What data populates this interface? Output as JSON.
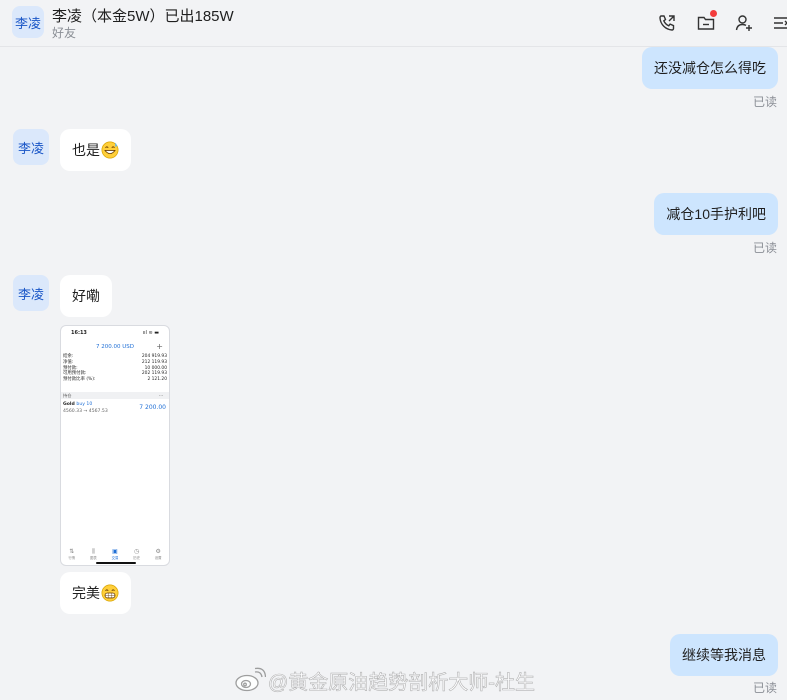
{
  "header": {
    "avatar_text": "李凌",
    "contact_name": "李凌（本金5W）已出185W",
    "subtitle": "好友",
    "icons": [
      "phone-share-icon",
      "folder-icon",
      "add-user-icon",
      "menu-list-icon"
    ]
  },
  "messages": [
    {
      "side": "out",
      "text": "还没减仓怎么得吃",
      "status": "已读"
    },
    {
      "side": "in",
      "avatar": "李凌",
      "text": "也是",
      "emoji": "beaming-grin-sweat-emoji"
    },
    {
      "side": "out",
      "text": "减仓10手护利吧",
      "status": "已读"
    },
    {
      "side": "in",
      "avatar": "李凌",
      "text": "好嘞"
    },
    {
      "side": "in",
      "type": "image"
    },
    {
      "side": "in",
      "text": "完美",
      "emoji": "grinning-emoji"
    },
    {
      "side": "out",
      "text": "继续等我消息",
      "status": "已读"
    }
  ],
  "screenshot": {
    "status_time": "16:13",
    "status_right": "ııl ≋ ▬",
    "balance": "7 200.00 USD",
    "plus": "+",
    "rows": [
      {
        "label": "结余:",
        "value": "204 919.93"
      },
      {
        "label": "净值:",
        "value": "212 119.93"
      },
      {
        "label": "预付款:",
        "value": "10 000.00"
      },
      {
        "label": "可用预付款:",
        "value": "202 119.93"
      },
      {
        "label": "预付款比率 (%):",
        "value": "2 121.20"
      }
    ],
    "section": "持仓",
    "section_more": "···",
    "position_symbol": "Gold",
    "position_side": "buy 10",
    "position_prices": "4560.33 → 4567.53",
    "position_pnl": "7 200.00",
    "tabs": [
      {
        "icon": "⇅",
        "label": "行情"
      },
      {
        "icon": "⫼",
        "label": "图表"
      },
      {
        "icon": "▣",
        "label": "交易"
      },
      {
        "icon": "◷",
        "label": "历史"
      },
      {
        "icon": "⚙",
        "label": "设置"
      }
    ]
  },
  "watermark": {
    "text": "@黄金原油趋势剖析大师-杜生"
  },
  "colors": {
    "background": "#f2f3f5",
    "incoming_bubble": "#ffffff",
    "outgoing_bubble": "#cde5fe",
    "avatar_bg": "#dbe8fb",
    "avatar_text": "#1a56c7",
    "notification_dot": "#f23c3c"
  }
}
